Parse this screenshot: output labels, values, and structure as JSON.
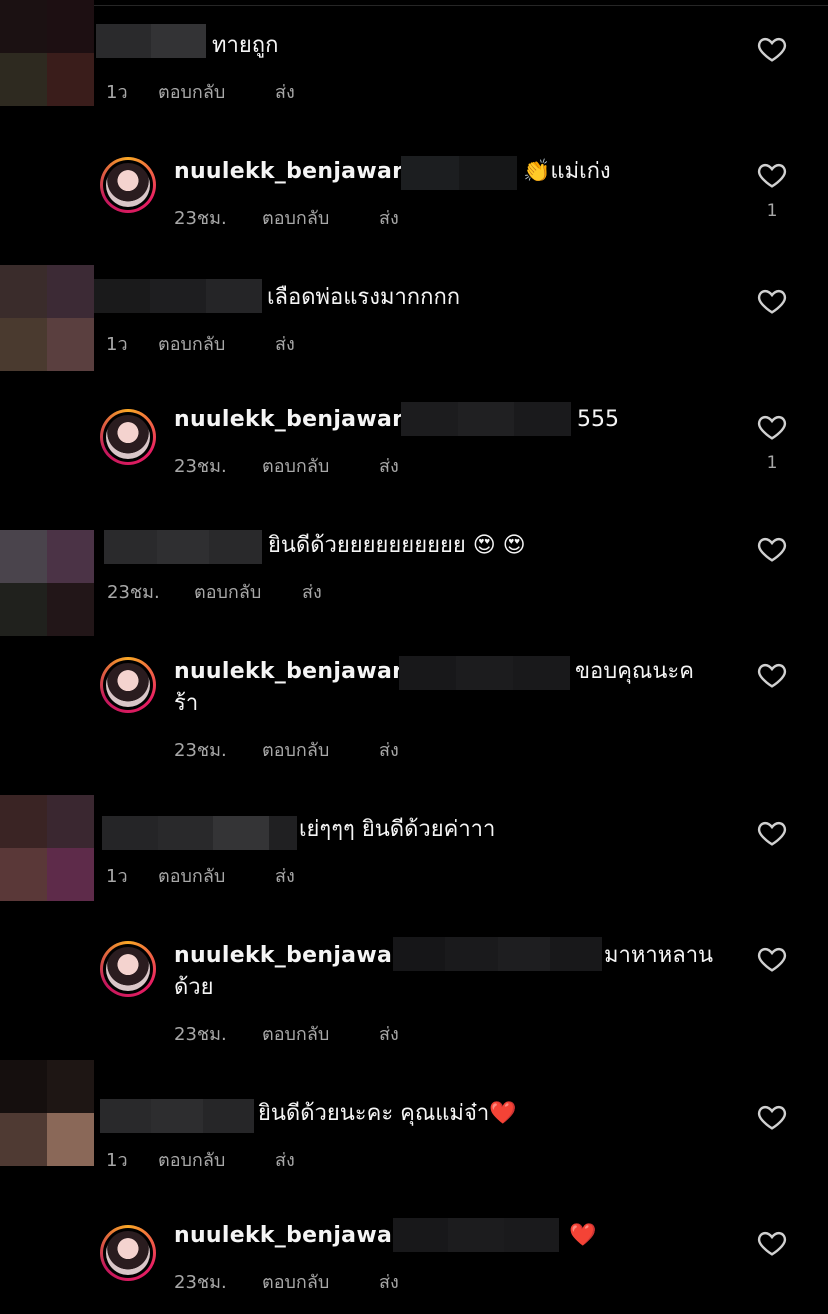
{
  "labels": {
    "reply": "ตอบกลับ",
    "send": "ส่ง"
  },
  "username": "nuulekk_benjawan",
  "comments": [
    {
      "text": "ทายถูก",
      "time": "1ว",
      "likes": ""
    },
    {
      "text": "👏แม่เก่ง",
      "time": "23ชม.",
      "likes": "1"
    },
    {
      "text": "เลือดพ่อแรงมากกกก",
      "time": "1ว",
      "likes": ""
    },
    {
      "text": "555",
      "time": "23ชม.",
      "likes": "1"
    },
    {
      "text": "ยินดีด้วยยยยยยยยยย 😍 😍",
      "time": "23ชม.",
      "likes": ""
    },
    {
      "text": "ขอบคุณนะค",
      "text2": "ร้า",
      "time": "23ชม.",
      "likes": ""
    },
    {
      "text": "เย่ๆๆๆ ยินดีด้วยค่าาา",
      "time": "1ว",
      "likes": ""
    },
    {
      "text": "มาหาหลาน",
      "text2": "ด้วย",
      "time": "23ชม.",
      "likes": ""
    },
    {
      "text": "ยินดีด้วยนะคะ คุณแม่จ๋า❤️",
      "time": "1ว",
      "likes": ""
    },
    {
      "text": "❤️",
      "time": "23ชม.",
      "likes": ""
    }
  ]
}
